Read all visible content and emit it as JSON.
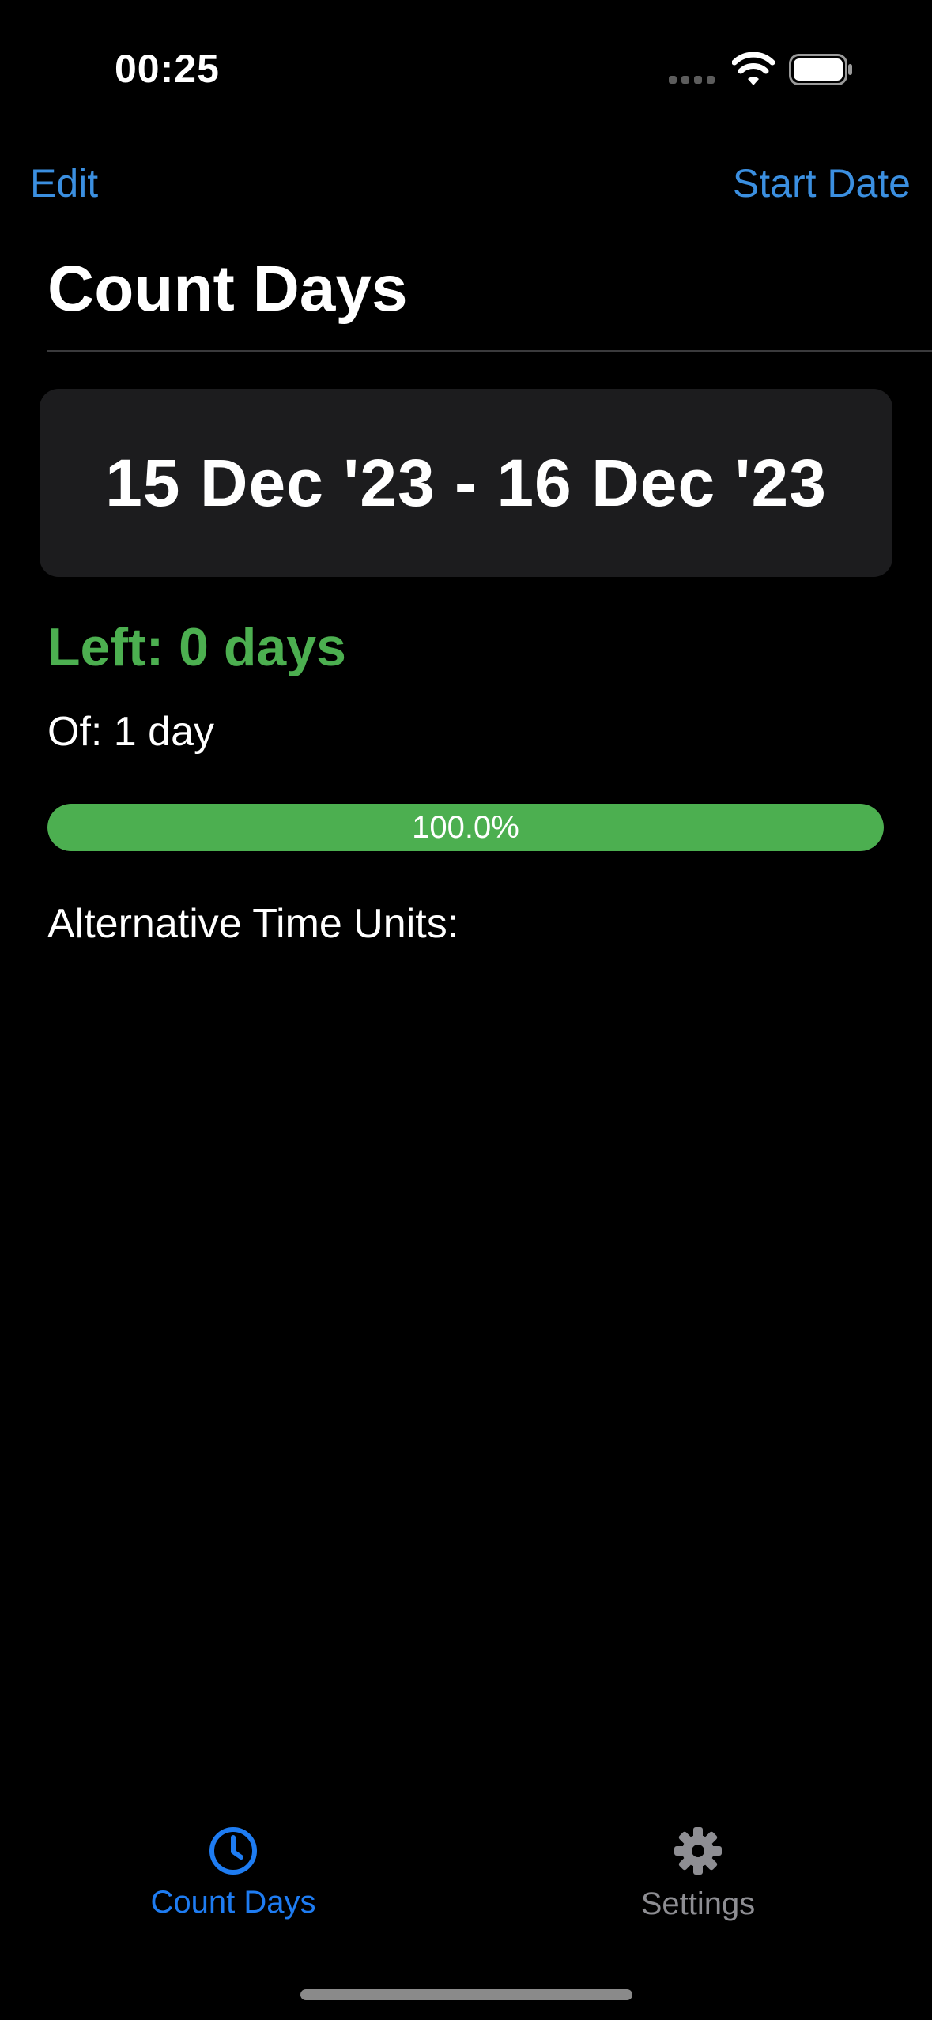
{
  "status_bar": {
    "time": "00:25",
    "icons": [
      "cellular-signal-icon",
      "wifi-icon",
      "battery-icon"
    ]
  },
  "nav": {
    "edit_label": "Edit",
    "start_date_label": "Start Date"
  },
  "page": {
    "title": "Count Days"
  },
  "date_card": {
    "range": "15 Dec '23 - 16 Dec '23"
  },
  "counts": {
    "left": "Left: 0 days",
    "total": "Of: 1 day"
  },
  "progress": {
    "value_fraction": 1.0,
    "label": "100.0%"
  },
  "alternative_units": {
    "heading": "Alternative Time Units:"
  },
  "tab_bar": {
    "items": [
      {
        "label": "Count Days",
        "icon": "clock-icon",
        "selected": true
      },
      {
        "label": "Settings",
        "icon": "gear-icon",
        "selected": false
      }
    ]
  },
  "colors": {
    "accent": "#1e7cf2",
    "nav_link": "#3b8fe0",
    "success": "#4caf50",
    "card_bg": "#1c1c1e",
    "inactive": "#8e8e93"
  }
}
